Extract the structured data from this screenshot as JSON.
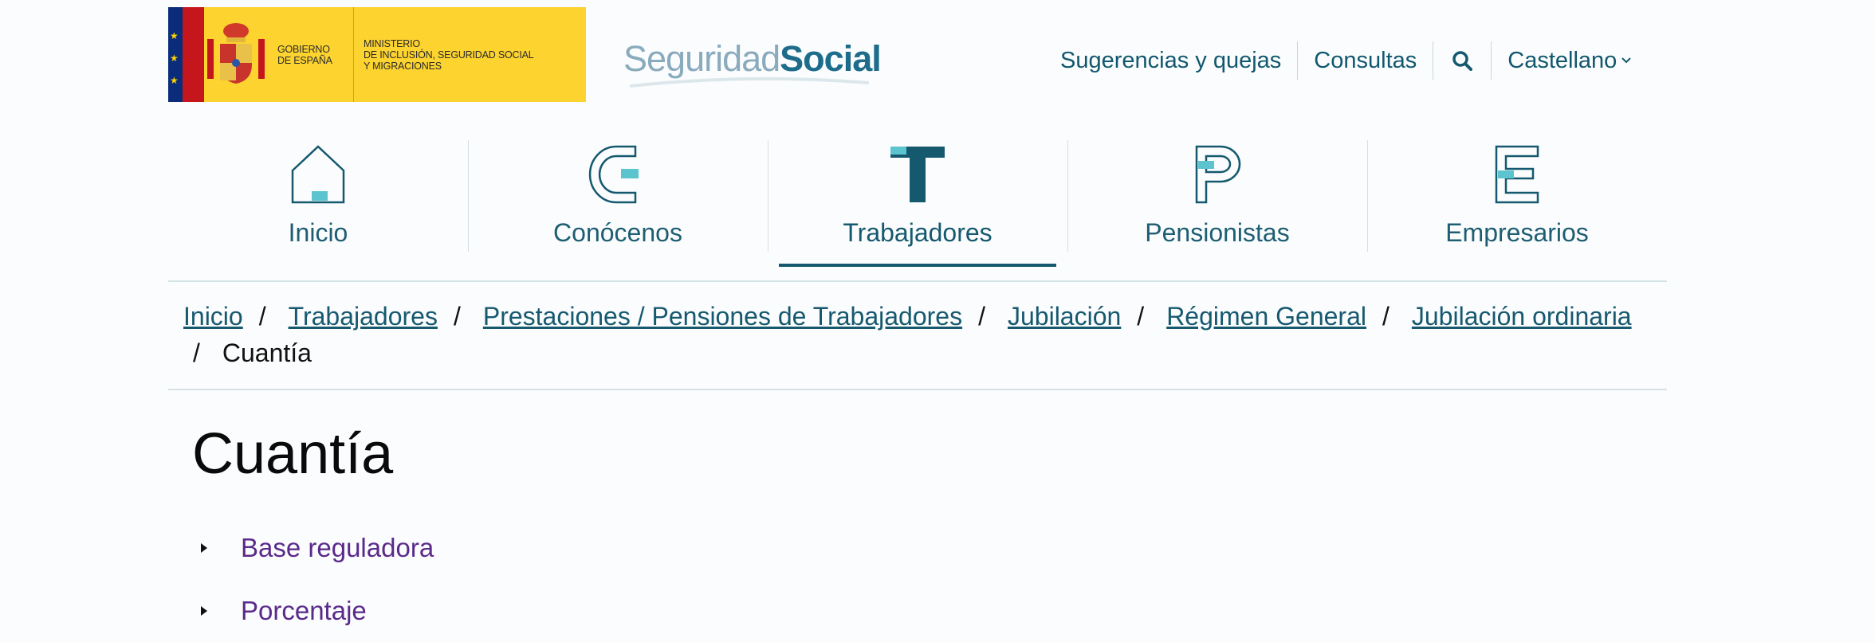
{
  "header": {
    "gov_label_line1": "GOBIERNO",
    "gov_label_line2": "DE ESPAÑA",
    "ministry_line1": "MINISTERIO",
    "ministry_line2": "DE INCLUSIÓN, SEGURIDAD SOCIAL",
    "ministry_line3": "Y MIGRACIONES",
    "brand_light": "Seguridad",
    "brand_bold": "Social"
  },
  "top_links": {
    "suggestions": "Sugerencias y quejas",
    "consultations": "Consultas",
    "language": "Castellano"
  },
  "nav": {
    "items": [
      {
        "label": "Inicio",
        "icon": "home-icon"
      },
      {
        "label": "Conócenos",
        "icon": "letter-c-icon"
      },
      {
        "label": "Trabajadores",
        "icon": "letter-t-icon"
      },
      {
        "label": "Pensionistas",
        "icon": "letter-p-icon"
      },
      {
        "label": "Empresarios",
        "icon": "letter-e-icon"
      }
    ],
    "active": "Trabajadores"
  },
  "breadcrumb": {
    "items": [
      "Inicio",
      "Trabajadores",
      "Prestaciones / Pensiones de Trabajadores",
      "Jubilación",
      "Régimen General",
      "Jubilación ordinaria"
    ],
    "current": "Cuantía",
    "separator": "/"
  },
  "page": {
    "title": "Cuantía",
    "accordion": [
      "Base reguladora",
      "Porcentaje"
    ]
  },
  "colors": {
    "primary": "#15596f",
    "accent": "#5bc4cf",
    "link_visited": "#5a2a8a",
    "logo_yellow": "#fcd32f"
  }
}
